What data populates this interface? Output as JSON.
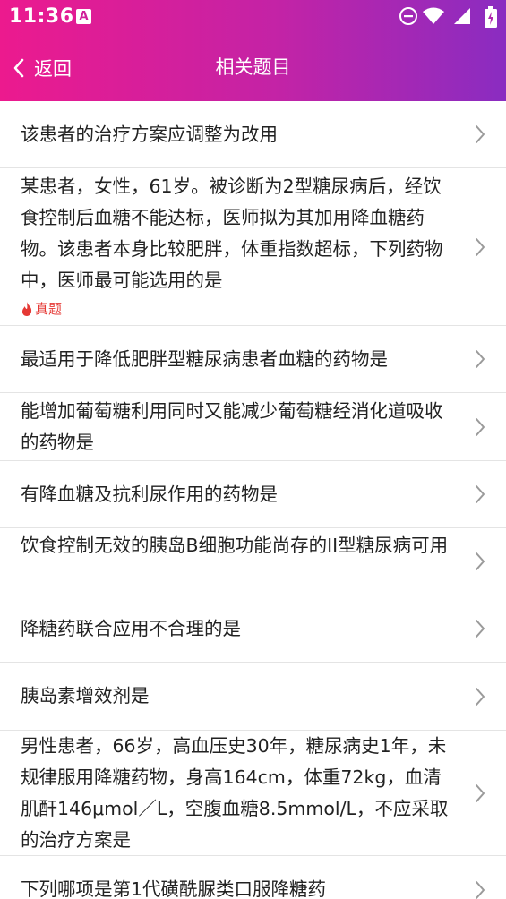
{
  "status": {
    "time": "11:36",
    "notif_letter": "A"
  },
  "nav": {
    "back_label": "返回",
    "title": "相关题目"
  },
  "colors": {
    "gradient_start": "#ec1a8e",
    "gradient_end": "#8a2cc1",
    "tag_color": "#e53935"
  },
  "questions": [
    {
      "text": "该患者的治疗方案应调整为改用",
      "tag": ""
    },
    {
      "text": "某患者，女性，61岁。被诊断为2型糖尿病后，经饮食控制后血糖不能达标，医师拟为其加用降血糖药物。该患者本身比较肥胖，体重指数超标，下列药物中，医师最可能选用的是",
      "tag": "真题"
    },
    {
      "text": "最适用于降低肥胖型糖尿病患者血糖的药物是",
      "tag": ""
    },
    {
      "text": "能增加葡萄糖利用同时又能减少葡萄糖经消化道吸收的药物是",
      "tag": ""
    },
    {
      "text": "有降血糖及抗利尿作用的药物是",
      "tag": ""
    },
    {
      "text": "饮食控制无效的胰岛B细胞功能尚存的II型糖尿病可用",
      "tag": ""
    },
    {
      "text": "降糖药联合应用不合理的是",
      "tag": ""
    },
    {
      "text": "胰岛素增效剂是",
      "tag": ""
    },
    {
      "text": "男性患者，66岁，高血压史30年，糖尿病史1年，未规律服用降糖药物，身高164cm，体重72kg，血清肌酐146μmol／L，空腹血糖8.5mmol/L，不应采取的治疗方案是",
      "tag": ""
    },
    {
      "text": "下列哪项是第1代磺酰脲类口服降糖药",
      "tag": ""
    }
  ]
}
